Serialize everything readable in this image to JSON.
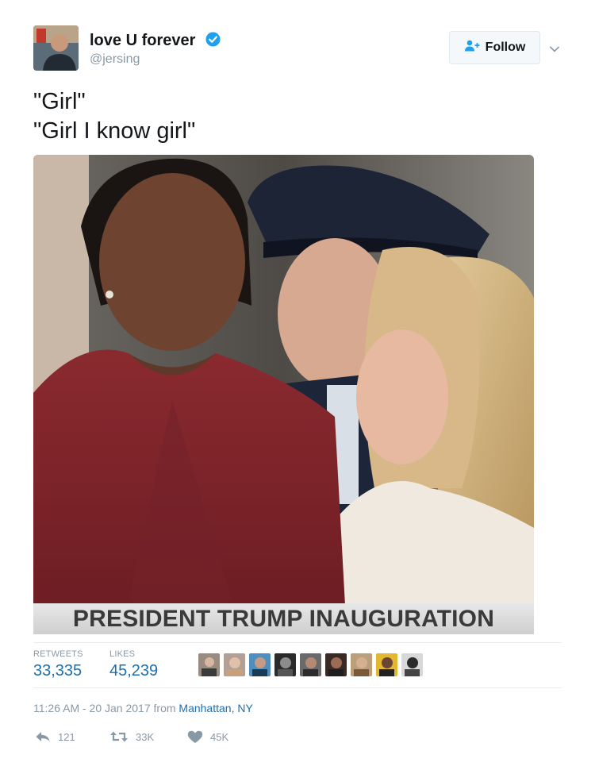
{
  "user": {
    "name": "love U forever",
    "handle": "@jersing"
  },
  "follow_button": {
    "label": "Follow"
  },
  "tweet": {
    "lines": [
      "\"Girl\"",
      "\"Girl I know girl\""
    ]
  },
  "media": {
    "caption": "PRESIDENT TRUMP INAUGURATION"
  },
  "stats": {
    "retweets_label": "RETWEETS",
    "retweets_value": "33,335",
    "likes_label": "LIKES",
    "likes_value": "45,239"
  },
  "meta": {
    "timestamp": "11:26 AM - 20 Jan 2017",
    "from_text": "from",
    "location": "Manhattan, NY"
  },
  "actions": {
    "reply_count": "121",
    "retweet_count": "33K",
    "like_count": "45K"
  },
  "colors": {
    "verified": "#1da1f2",
    "link": "#1c6faf",
    "muted": "#8899a6"
  },
  "icons": [
    "verified-badge-icon",
    "follow-person-icon",
    "chevron-down-icon",
    "reply-icon",
    "retweet-icon",
    "heart-icon"
  ]
}
